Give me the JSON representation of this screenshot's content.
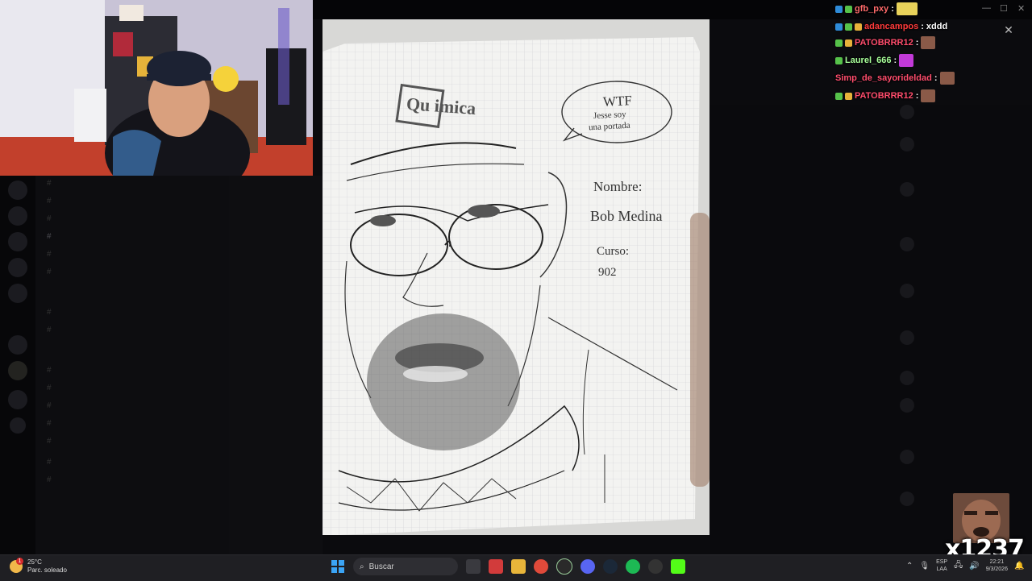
{
  "chat": {
    "messages": [
      {
        "user": "gfb_pxy",
        "user_color": "#ff6b6b",
        "message": ""
      },
      {
        "user": "adancampos",
        "user_color": "#ff3b3b",
        "message": "xddd"
      },
      {
        "user": "PATOBRRR12",
        "user_color": "#ff4d6d",
        "message": ""
      },
      {
        "user": "Laurel_666",
        "user_color": "#a8ff9a",
        "message": ""
      },
      {
        "user": "Simp_de_sayorideldad",
        "user_color": "#ff4d6d",
        "message": ""
      },
      {
        "user": "PATOBRRR12",
        "user_color": "#ff4d6d",
        "message": ""
      }
    ]
  },
  "drawing": {
    "logo_text": "Qu imica",
    "bubble_line1": "WTF",
    "bubble_line2": "Jesse soy",
    "bubble_line3": "una portada",
    "name_label": "Nombre:",
    "name_value": "Bob Medina",
    "course_label": "Curso:",
    "course_value": "902"
  },
  "counter": {
    "value": "x1237"
  },
  "taskbar": {
    "weather_temp": "25°C",
    "weather_desc": "Parc. soleado",
    "weather_badge": "1",
    "search_placeholder": "Buscar",
    "lang_line1": "ESP",
    "lang_line2": "LAA",
    "time": "22:21",
    "date": "9/3/2026"
  },
  "colors": {
    "taskbar_bg": "#1f1f23",
    "chat_name_red": "#ff4d6d",
    "chat_name_green": "#a8ff9a"
  }
}
